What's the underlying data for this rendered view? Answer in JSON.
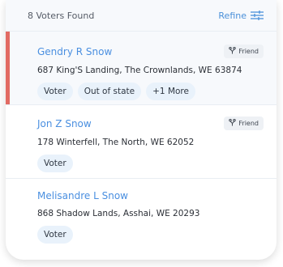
{
  "header": {
    "count_label": "8 Voters Found",
    "refine_label": "Refine",
    "refine_icon": "sliders-icon"
  },
  "voters": [
    {
      "name": "Gendry R Snow",
      "badge": "Friend",
      "badge_icon": "friend-icon",
      "address": "687 King'S Landing, The Crownlands, WE 63874",
      "tags": [
        "Voter",
        "Out of state",
        "+1 More"
      ]
    },
    {
      "name": "Jon Z Snow",
      "badge": "Friend",
      "badge_icon": "friend-icon",
      "address": "178 Winterfell, The North, WE 62052",
      "tags": [
        "Voter"
      ]
    },
    {
      "name": "Melisandre L Snow",
      "address": "868 Shadow Lands, Asshai, WE 20293",
      "tags": [
        "Voter"
      ]
    }
  ],
  "colors": {
    "accent": "#4a90d9",
    "active_bar": "#e26b63",
    "tag_bg": "#e9f2fb"
  }
}
